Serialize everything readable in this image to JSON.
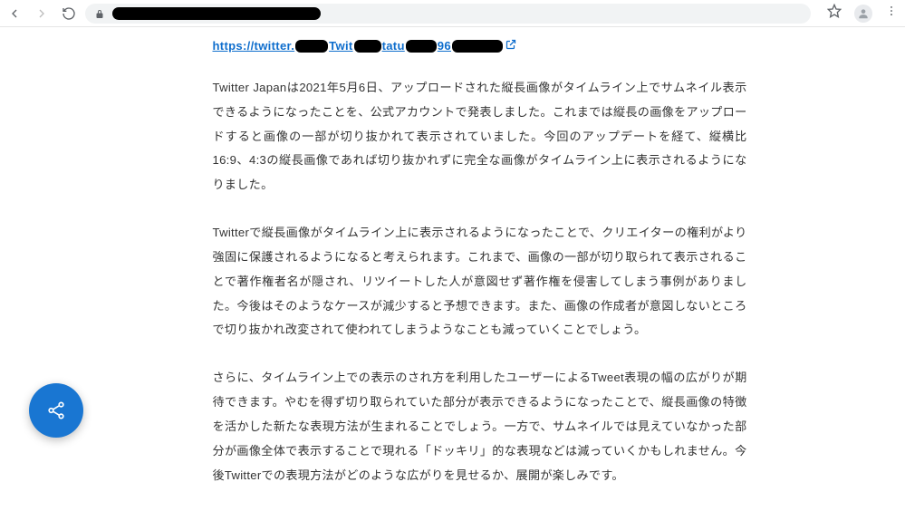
{
  "browser": {
    "url_visible_prefix": "",
    "url_redacted": true
  },
  "link": {
    "prefix": "https://twitter.",
    "mid1": "Twit",
    "mid2": "tatu",
    "mid3": "96"
  },
  "paragraphs": {
    "p1": "Twitter Japanは2021年5月6日、アップロードされた縦長画像がタイムライン上でサムネイル表示できるようになったことを、公式アカウントで発表しました。これまでは縦長の画像をアップロードすると画像の一部が切り抜かれて表示されていました。今回のアップデートを経て、縦横比16:9、4:3の縦長画像であれば切り抜かれずに完全な画像がタイムライン上に表示されるようになりました。",
    "p2": "Twitterで縦長画像がタイムライン上に表示されるようになったことで、クリエイターの権利がより強固に保護されるようになると考えられます。これまで、画像の一部が切り取られて表示されることで著作権者名が隠され、リツイートした人が意図せず著作権を侵害してしまう事例がありました。今後はそのようなケースが減少すると予想できます。また、画像の作成者が意図しないところで切り抜かれ改変されて使われてしまうようなことも減っていくことでしょう。",
    "p3": "さらに、タイムライン上での表示のされ方を利用したユーザーによるTweet表現の幅の広がりが期待できます。やむを得ず切り取られていた部分が表示できるようになったことで、縦長画像の特徴を活かした新たな表現方法が生まれることでしょう。一方で、サムネイルでは見えていなかった部分が画像全体で表示することで現れる「ドッキリ」的な表現などは減っていくかもしれません。今後Twitterでの表現方法がどのような広がりを見せるか、展開が楽しみです。"
  }
}
